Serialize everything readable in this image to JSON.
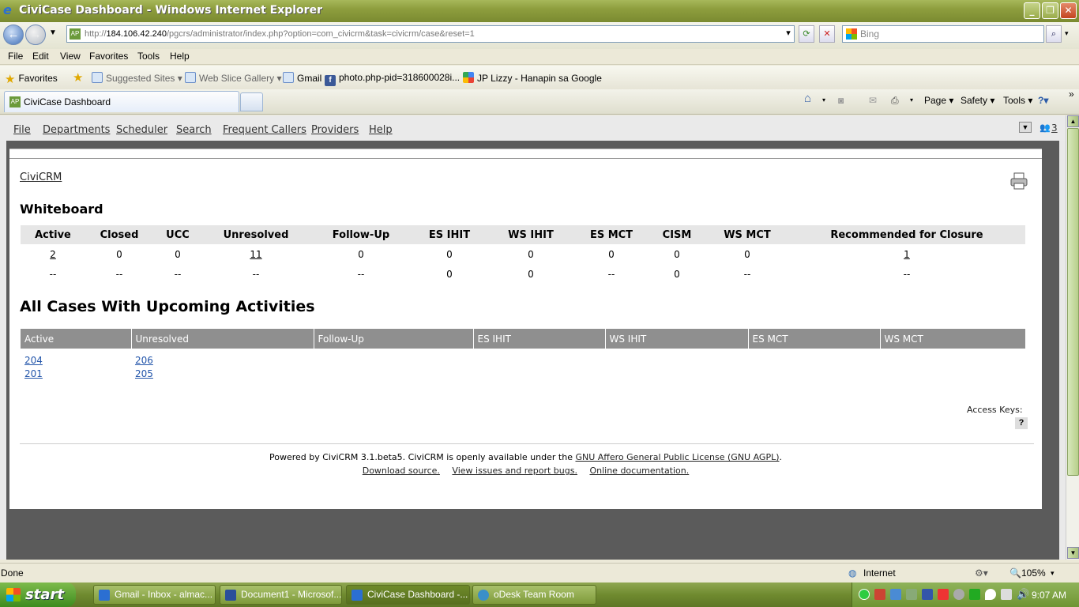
{
  "window": {
    "title": "CiviCase Dashboard - Windows Internet Explorer",
    "url_prefix": "http://",
    "url_host": "184.106.42.240",
    "url_path": "/pgcrs/administrator/index.php?option=com_civicrm&task=civicrm/case&reset=1",
    "search_placeholder": "Bing"
  },
  "menu": [
    "File",
    "Edit",
    "View",
    "Favorites",
    "Tools",
    "Help"
  ],
  "favorites": {
    "label": "Favorites",
    "items": [
      "Suggested Sites ▾",
      "Web Slice Gallery ▾",
      "Gmail",
      "photo.php-pid=318600028i...",
      "JP Lizzy - Hanapin sa Google"
    ]
  },
  "tab": {
    "label": "CiviCase Dashboard"
  },
  "commandbar": {
    "page": "Page ▾",
    "safety": "Safety ▾",
    "tools": "Tools ▾"
  },
  "appnav": [
    "File",
    "Departments",
    "Scheduler",
    "Search",
    "Frequent Callers",
    "Providers",
    "Help"
  ],
  "appnav_counter": "3",
  "breadcrumb": "CiviCRM",
  "whiteboard": {
    "title": "Whiteboard",
    "headers": [
      "Active",
      "Closed",
      "UCC",
      "Unresolved",
      "Follow-Up",
      "ES IHIT",
      "WS IHIT",
      "ES MCT",
      "CISM",
      "WS MCT",
      "Recommended for Closure"
    ],
    "rows": [
      [
        "2",
        "0",
        "0",
        "11",
        "0",
        "0",
        "0",
        "0",
        "0",
        "0",
        "1"
      ],
      [
        "--",
        "--",
        "--",
        "--",
        "--",
        "0",
        "0",
        "--",
        "0",
        "--",
        "--"
      ]
    ],
    "links": [
      [
        true,
        false,
        false,
        true,
        false,
        false,
        false,
        false,
        false,
        false,
        true
      ]
    ]
  },
  "upcoming": {
    "title": "All Cases With Upcoming Activities",
    "headers": [
      "Active",
      "Unresolved",
      "Follow-Up",
      "ES IHIT",
      "WS IHIT",
      "ES MCT",
      "WS MCT"
    ],
    "rows": [
      [
        "204",
        "206",
        "",
        "",
        "",
        "",
        ""
      ],
      [
        "201",
        "205",
        "",
        "",
        "",
        "",
        ""
      ]
    ]
  },
  "access_keys": {
    "label": "Access Keys:",
    "button": "?"
  },
  "footer": {
    "powered_prefix": "Powered by CiviCRM 3.1.beta5. CiviCRM is openly available under the ",
    "license_link": "GNU Affero General Public License (GNU AGPL)",
    "powered_suffix": ".",
    "links": [
      "Download source.",
      "View issues and report bugs.",
      "Online documentation."
    ]
  },
  "status": {
    "text": "Done",
    "zone": "Internet",
    "zoom": "105%"
  },
  "taskbar": {
    "start": "start",
    "tasks": [
      "Gmail - Inbox - almac...",
      "Document1 - Microsof...",
      "CiviCase Dashboard -...",
      "oDesk Team Room"
    ],
    "clock": "9:07 AM"
  },
  "colors": {
    "window_chrome": "#8e9e3e",
    "table_header_dark": "#8f8f8f",
    "link": "#2255aa"
  }
}
